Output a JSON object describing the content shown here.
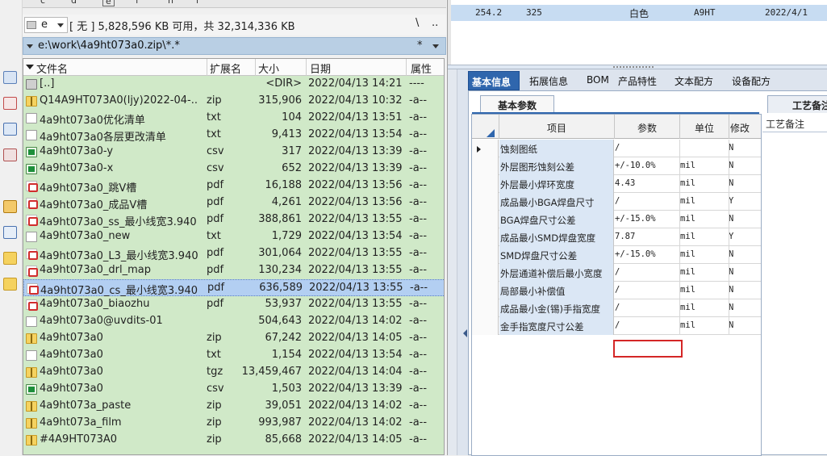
{
  "drives": {
    "letters": [
      "c",
      "d",
      "e",
      "f",
      "h",
      "i"
    ],
    "current": "e",
    "info": "[ 无 ]  5,828,596 KB 可用，共 32,314,336 KB",
    "root_btn": "\\",
    "up_btn": ".."
  },
  "path": {
    "text": "e:\\work\\4a9ht073a0.zip\\*.*",
    "filter": "*"
  },
  "file_list": {
    "columns": {
      "name": "文件名",
      "ext": "扩展名",
      "size": "大小",
      "date": "日期",
      "attr": "属性"
    },
    "rows": [
      {
        "icon": "up",
        "name": "[..]",
        "ext": "",
        "size": "<DIR>",
        "date": "2022/04/13 14:21",
        "attr": "----"
      },
      {
        "icon": "zip",
        "name": "Q14A9HT073A0(ljy)2022-04-..",
        "ext": "zip",
        "size": "315,906",
        "date": "2022/04/13 10:32",
        "attr": "-a--"
      },
      {
        "icon": "txt",
        "name": "4a9ht073a0优化清单",
        "ext": "txt",
        "size": "104",
        "date": "2022/04/13 13:51",
        "attr": "-a--"
      },
      {
        "icon": "txt",
        "name": "4a9ht073a0各层更改清单",
        "ext": "txt",
        "size": "9,413",
        "date": "2022/04/13 13:54",
        "attr": "-a--"
      },
      {
        "icon": "csv",
        "name": "4a9ht073a0-y",
        "ext": "csv",
        "size": "317",
        "date": "2022/04/13 13:39",
        "attr": "-a--"
      },
      {
        "icon": "csv",
        "name": "4a9ht073a0-x",
        "ext": "csv",
        "size": "652",
        "date": "2022/04/13 13:39",
        "attr": "-a--"
      },
      {
        "icon": "pdf",
        "name": "4a9ht073a0_跳V槽",
        "ext": "pdf",
        "size": "16,188",
        "date": "2022/04/13 13:56",
        "attr": "-a--"
      },
      {
        "icon": "pdf",
        "name": "4a9ht073a0_成品V槽",
        "ext": "pdf",
        "size": "4,261",
        "date": "2022/04/13 13:56",
        "attr": "-a--"
      },
      {
        "icon": "pdf",
        "name": "4a9ht073a0_ss_最小线宽3.940",
        "ext": "pdf",
        "size": "388,861",
        "date": "2022/04/13 13:55",
        "attr": "-a--"
      },
      {
        "icon": "txt",
        "name": "4a9ht073a0_new",
        "ext": "txt",
        "size": "1,729",
        "date": "2022/04/13 13:54",
        "attr": "-a--"
      },
      {
        "icon": "pdf",
        "name": "4a9ht073a0_L3_最小线宽3.940",
        "ext": "pdf",
        "size": "301,064",
        "date": "2022/04/13 13:55",
        "attr": "-a--"
      },
      {
        "icon": "pdf",
        "name": "4a9ht073a0_drl_map",
        "ext": "pdf",
        "size": "130,234",
        "date": "2022/04/13 13:55",
        "attr": "-a--"
      },
      {
        "icon": "pdf",
        "name": "4a9ht073a0_cs_最小线宽3.940",
        "ext": "pdf",
        "size": "636,589",
        "date": "2022/04/13 13:55",
        "attr": "-a--",
        "selected": true
      },
      {
        "icon": "pdf",
        "name": "4a9ht073a0_biaozhu",
        "ext": "pdf",
        "size": "53,937",
        "date": "2022/04/13 13:55",
        "attr": "-a--"
      },
      {
        "icon": "txt",
        "name": "4a9ht073a0@uvdits-01",
        "ext": "",
        "size": "504,643",
        "date": "2022/04/13 14:02",
        "attr": "-a--"
      },
      {
        "icon": "zip",
        "name": "4a9ht073a0",
        "ext": "zip",
        "size": "67,242",
        "date": "2022/04/13 14:05",
        "attr": "-a--"
      },
      {
        "icon": "txt",
        "name": "4a9ht073a0",
        "ext": "txt",
        "size": "1,154",
        "date": "2022/04/13 13:54",
        "attr": "-a--"
      },
      {
        "icon": "zip",
        "name": "4a9ht073a0",
        "ext": "tgz",
        "size": "13,459,467",
        "date": "2022/04/13 14:04",
        "attr": "-a--"
      },
      {
        "icon": "csv",
        "name": "4a9ht073a0",
        "ext": "csv",
        "size": "1,503",
        "date": "2022/04/13 13:39",
        "attr": "-a--"
      },
      {
        "icon": "zip",
        "name": "4a9ht073a_paste",
        "ext": "zip",
        "size": "39,051",
        "date": "2022/04/13 14:02",
        "attr": "-a--"
      },
      {
        "icon": "zip",
        "name": "4a9ht073a_film",
        "ext": "zip",
        "size": "993,987",
        "date": "2022/04/13 14:02",
        "attr": "-a--"
      },
      {
        "icon": "zip",
        "name": "#4A9HT073A0",
        "ext": "zip",
        "size": "85,668",
        "date": "2022/04/13 14:05",
        "attr": "-a--"
      }
    ]
  },
  "top_grid": {
    "row": [
      "254.2",
      "325",
      "白色",
      "A9HT",
      "2022/4/1"
    ]
  },
  "tabs": {
    "items": [
      "基本信息",
      "拓展信息",
      "BOM",
      "产品特性",
      "文本配方",
      "设备配方"
    ],
    "active": "基本信息",
    "sub_tab": "基本参数",
    "sub_tab2": "工艺备注",
    "remark_label": "工艺备注"
  },
  "param_grid": {
    "columns": {
      "item": "项目",
      "param": "参数",
      "unit": "单位",
      "modify": "修改"
    },
    "rows": [
      {
        "item": "蚀刻图纸",
        "param": "/",
        "unit": "",
        "modify": "N"
      },
      {
        "item": "外层图形蚀刻公差",
        "param": "+/-10.0%",
        "unit": "mil",
        "modify": "N"
      },
      {
        "item": "外层最小焊环宽度",
        "param": "4.43",
        "unit": "mil",
        "modify": "N"
      },
      {
        "item": "成品最小BGA焊盘尺寸",
        "param": "/",
        "unit": "mil",
        "modify": "Y"
      },
      {
        "item": "BGA焊盘尺寸公差",
        "param": "+/-15.0%",
        "unit": "mil",
        "modify": "N"
      },
      {
        "item": "成品最小SMD焊盘宽度",
        "param": "7.87",
        "unit": "mil",
        "modify": "Y"
      },
      {
        "item": "SMD焊盘尺寸公差",
        "param": "+/-15.0%",
        "unit": "mil",
        "modify": "N"
      },
      {
        "item": "外层通道补偿后最小宽度",
        "param": "/",
        "unit": "mil",
        "modify": "N"
      },
      {
        "item": "局部最小补偿值",
        "param": "/",
        "unit": "mil",
        "modify": "N"
      },
      {
        "item": "成品最小金(锡)手指宽度",
        "param": "/",
        "unit": "mil",
        "modify": "N"
      },
      {
        "item": "金手指宽度尺寸公差",
        "param": "/",
        "unit": "mil",
        "modify": "N"
      }
    ]
  },
  "colors": {
    "file_bg": "#d0e9c8",
    "selected_row": "#b3cff2",
    "tab_active": "#2f66ad",
    "highlight": "#d42626"
  }
}
